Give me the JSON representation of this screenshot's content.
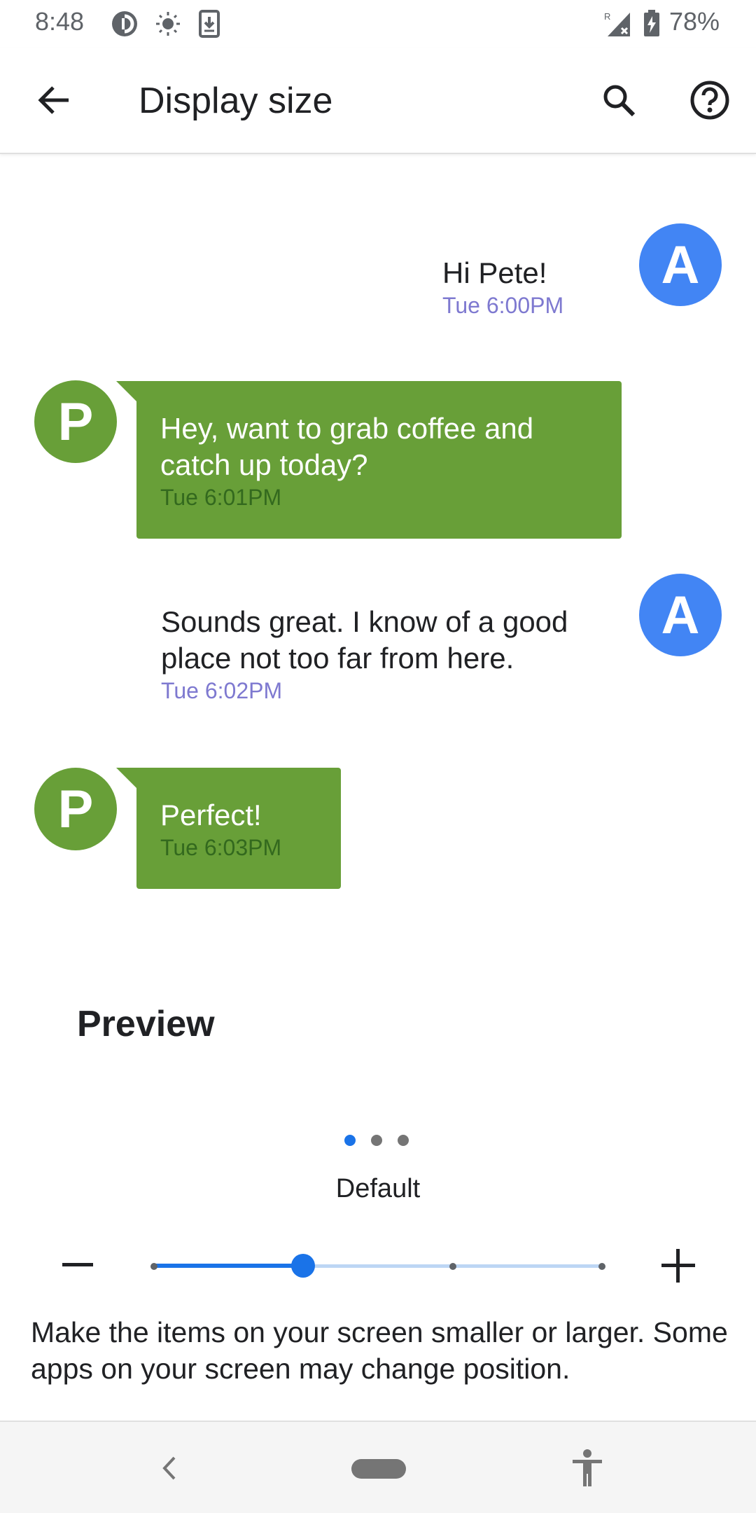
{
  "status_bar": {
    "time": "8:48",
    "battery": "78%",
    "icons": [
      "pocket-casts-icon",
      "brightness-icon",
      "download-icon",
      "signal-roaming-icon",
      "battery-charging-icon"
    ]
  },
  "app_bar": {
    "title": "Display size",
    "icons": [
      "back-arrow-icon",
      "search-icon",
      "help-icon"
    ]
  },
  "conversation": [
    {
      "sender": "A",
      "side": "right",
      "text": "Hi Pete!",
      "time": "Tue 6:00PM"
    },
    {
      "sender": "P",
      "side": "left",
      "text": "Hey, want to grab coffee and catch up today?",
      "time": "Tue 6:01PM"
    },
    {
      "sender": "A",
      "side": "right",
      "text": "Sounds great. I know of a good place not too far from here.",
      "time": "Tue 6:02PM"
    },
    {
      "sender": "P",
      "side": "left",
      "text": "Perfect!",
      "time": "Tue 6:03PM"
    }
  ],
  "preview_label": "Preview",
  "size_selector": {
    "label": "Default",
    "steps": 4,
    "selected_index": 1,
    "page_dots": 3,
    "active_dot": 0
  },
  "description": "Make the items on your screen smaller or larger. Some apps on your screen may change position.",
  "colors": {
    "accent": "#1a73e8",
    "avatar_a": "#4285f4",
    "bubble_p": "#689f38",
    "time_purple": "#7e79d0"
  }
}
